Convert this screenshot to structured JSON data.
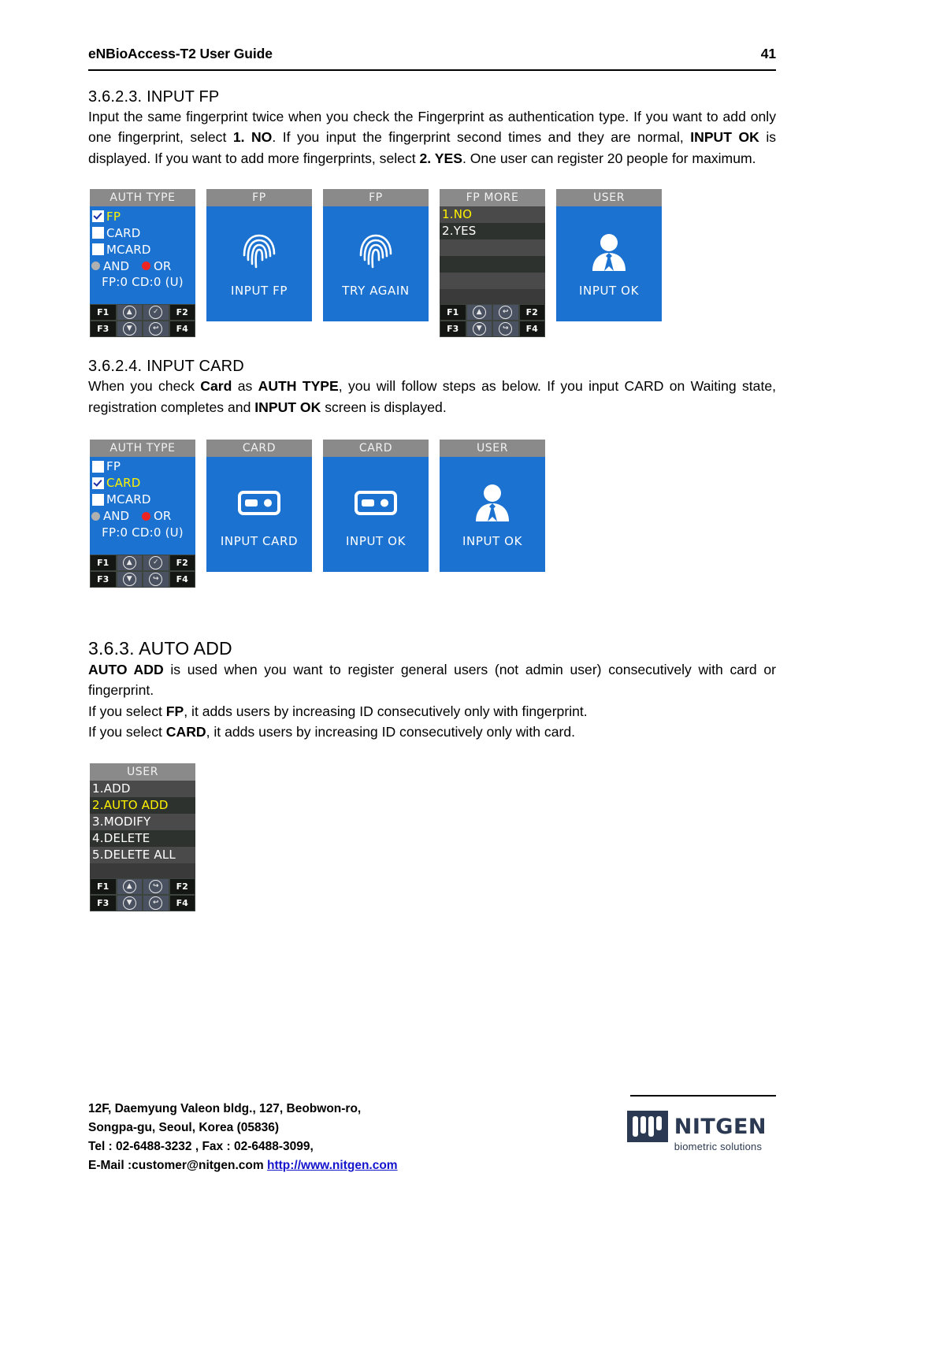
{
  "header": {
    "title": "eNBioAccess-T2 User Guide",
    "page_number": "41"
  },
  "sections": {
    "input_fp": {
      "heading": "3.6.2.3. INPUT FP",
      "paragraph_parts": {
        "p1": "Input the same fingerprint twice when you check the Fingerprint as authentication type. If you want to add only one fingerprint, select ",
        "b1": "1. NO",
        "p2": ". If you input the fingerprint second times and they are normal, ",
        "b2": "INPUT OK",
        "p3": " is displayed. If you want to add more fingerprints, select ",
        "b3": "2. YES",
        "p4": ". One user can register 20 people for maximum."
      }
    },
    "input_card": {
      "heading": "3.6.2.4. INPUT CARD",
      "paragraph_parts": {
        "p1": "When you check ",
        "b1": "Card",
        "p2": " as ",
        "b2": "AUTH TYPE",
        "p3": ", you will follow steps as below. If you input CARD on Waiting state, registration completes and ",
        "b3": "INPUT OK",
        "p4": " screen is displayed."
      }
    },
    "auto_add": {
      "heading": "3.6.3.  AUTO ADD",
      "paragraph_parts": {
        "b1": "AUTO ADD",
        "p1": " is used when you want to register general users (not admin user) consecutively with card or fingerprint.",
        "l2a": "If you select ",
        "l2b": "FP",
        "l2c": ", it adds users by increasing ID consecutively only with fingerprint.",
        "l3a": "If you select ",
        "l3b": "CARD",
        "l3c": ", it adds users by increasing ID consecutively only with card."
      }
    }
  },
  "fp_screens": [
    {
      "title": "AUTH TYPE",
      "kind": "auth-type",
      "options": [
        {
          "label": "FP",
          "checked": true,
          "highlight": true
        },
        {
          "label": "CARD",
          "checked": false,
          "highlight": false
        },
        {
          "label": "MCARD",
          "checked": false,
          "highlight": false
        }
      ],
      "radios": [
        {
          "label": "AND",
          "color": "gray"
        },
        {
          "label": "OR",
          "color": "red"
        }
      ],
      "counts": "FP:0 CD:0 (U)",
      "keypad": {
        "row1": [
          "F1",
          "up-arrow-icon",
          "check-icon",
          "F2"
        ],
        "row2": [
          "F3",
          "down-arrow-icon",
          "back-arrow-icon",
          "F4"
        ]
      }
    },
    {
      "title": "FP",
      "kind": "icon",
      "icon": "fingerprint-icon",
      "caption": "INPUT FP",
      "keypad": null
    },
    {
      "title": "FP",
      "kind": "icon",
      "icon": "fingerprint-icon",
      "caption": "TRY AGAIN",
      "keypad": null
    },
    {
      "title": "FP MORE",
      "kind": "menu",
      "menu": [
        {
          "label": "1.NO",
          "selected": true
        },
        {
          "label": "2.YES",
          "selected": false
        },
        {
          "label": "",
          "selected": false
        },
        {
          "label": "",
          "selected": false
        },
        {
          "label": "",
          "selected": false
        }
      ],
      "keypad": {
        "row1": [
          "F1",
          "up-arrow-icon",
          "back-arrow-icon",
          "F2"
        ],
        "row2": [
          "F3",
          "down-arrow-icon",
          "forward-arrow-icon",
          "F4"
        ]
      }
    },
    {
      "title": "USER",
      "kind": "icon",
      "icon": "user-icon",
      "caption": "INPUT OK",
      "keypad": null
    }
  ],
  "card_screens": [
    {
      "title": "AUTH TYPE",
      "kind": "auth-type",
      "options": [
        {
          "label": "FP",
          "checked": false,
          "highlight": false
        },
        {
          "label": "CARD",
          "checked": true,
          "highlight": true
        },
        {
          "label": "MCARD",
          "checked": false,
          "highlight": false
        }
      ],
      "radios": [
        {
          "label": "AND",
          "color": "gray"
        },
        {
          "label": "OR",
          "color": "red"
        }
      ],
      "counts": "FP:0 CD:0 (U)",
      "keypad": {
        "row1": [
          "F1",
          "up-arrow-icon",
          "check-icon",
          "F2"
        ],
        "row2": [
          "F3",
          "down-arrow-icon",
          "forward-arrow-icon",
          "F4"
        ]
      }
    },
    {
      "title": "CARD",
      "kind": "icon",
      "icon": "card-icon",
      "caption": "INPUT CARD",
      "keypad": null
    },
    {
      "title": "CARD",
      "kind": "icon",
      "icon": "card-icon",
      "caption": "INPUT OK",
      "keypad": null
    },
    {
      "title": "USER",
      "kind": "icon",
      "icon": "user-icon",
      "caption": "INPUT OK",
      "keypad": null
    }
  ],
  "user_menu_screen": {
    "title": "USER",
    "menu": [
      {
        "label": "1.ADD",
        "selected": false
      },
      {
        "label": "2.AUTO ADD",
        "selected": true
      },
      {
        "label": "3.MODIFY",
        "selected": false
      },
      {
        "label": "4.DELETE",
        "selected": false
      },
      {
        "label": "5.DELETE ALL",
        "selected": false
      }
    ],
    "keypad": {
      "row1": [
        "F1",
        "up-arrow-icon",
        "forward-arrow-icon",
        "F2"
      ],
      "row2": [
        "F3",
        "down-arrow-icon",
        "back-arrow-icon",
        "F4"
      ]
    }
  },
  "footer": {
    "line1": "12F, Daemyung Valeon bldg., 127, Beobwon-ro,",
    "line2": "Songpa-gu, Seoul, Korea (05836)",
    "line3": "Tel : 02-6488-3232 , Fax : 02-6488-3099,",
    "line4_label": "E-Mail :customer@nitgen.com ",
    "line4_link": "http://www.nitgen.com",
    "logo_word": "NITGEN",
    "logo_sub": "biometric solutions"
  },
  "colors": {
    "screen_blue": "#1b72d0",
    "title_gray": "#8a8a8a",
    "highlight_yellow": "#fff200",
    "radio_red": "#ec2424",
    "link_blue": "#1414cc",
    "logo_navy": "#2b3a52"
  }
}
